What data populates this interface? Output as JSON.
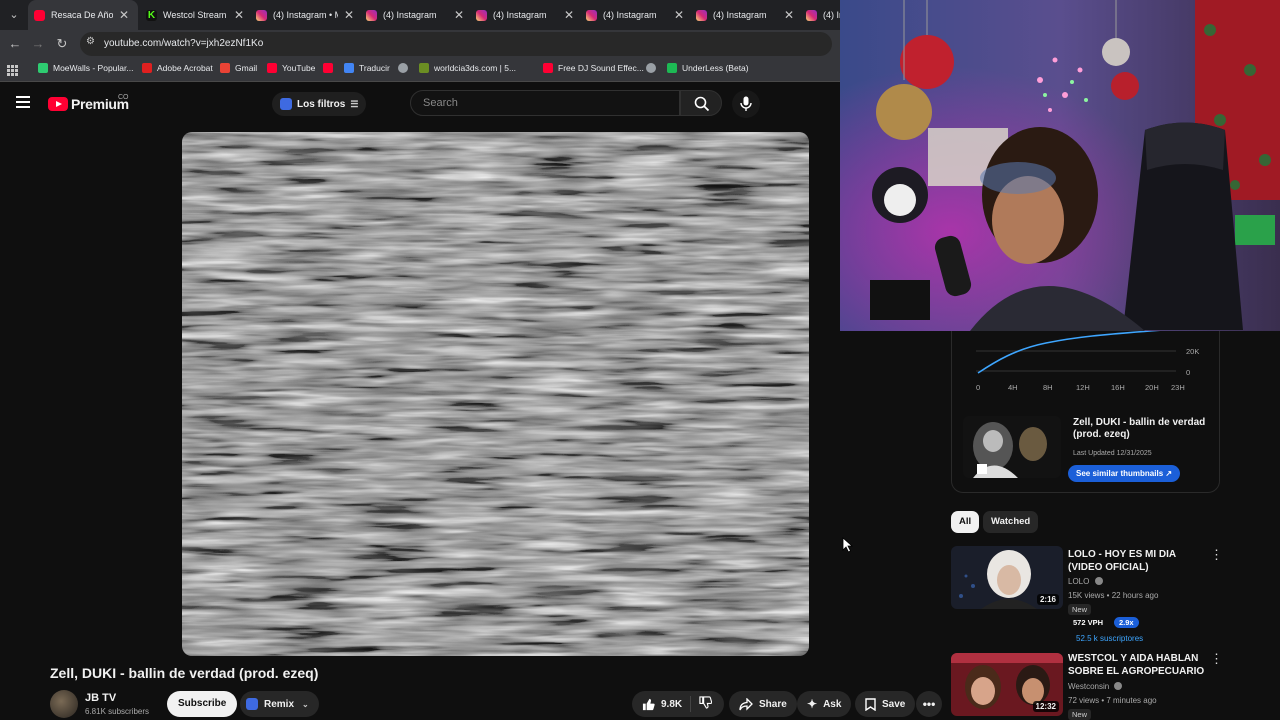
{
  "browser": {
    "tabs": [
      {
        "title": "Resaca De Año N",
        "icon": "youtube-icon"
      },
      {
        "title": "Westcol Stream -",
        "icon": "kick-icon"
      },
      {
        "title": "(4) Instagram • M",
        "icon": "instagram-icon"
      },
      {
        "title": "(4) Instagram",
        "icon": "instagram-icon"
      },
      {
        "title": "(4) Instagram",
        "icon": "instagram-icon"
      },
      {
        "title": "(4) Instagram",
        "icon": "instagram-icon"
      },
      {
        "title": "(4) Instagram",
        "icon": "instagram-icon"
      },
      {
        "title": "(4) In",
        "icon": "instagram-icon"
      }
    ],
    "url": "youtube.com/watch?v=jxh2ezNf1Ko",
    "bookmarks": [
      {
        "label": "MoeWalls - Popular...",
        "color": "#2ecc71"
      },
      {
        "label": "Adobe Acrobat",
        "color": "#e02020"
      },
      {
        "label": "Gmail",
        "color": "#ea4335"
      },
      {
        "label": "YouTube",
        "color": "#ff0033"
      },
      {
        "label": "",
        "color": "#ff0033"
      },
      {
        "label": "Traducir",
        "color": "#4285f4"
      },
      {
        "label": "",
        "color": "#9aa0a6"
      },
      {
        "label": "worldcia3ds.com | 5...",
        "color": "#6b8e23"
      },
      {
        "label": "Free DJ Sound Effec...",
        "color": "#ff0033"
      },
      {
        "label": "",
        "color": "#9aa0a6"
      },
      {
        "label": "UnderLess (Beta)",
        "color": "#1db954"
      }
    ]
  },
  "yt": {
    "logo_text": "Premium",
    "country": "CO",
    "filters_label": "Los filtros",
    "search_placeholder": "Search"
  },
  "video": {
    "title": "Zell, DUKI - ballin de verdad (prod. ezeq)",
    "channel": "JB TV",
    "subscribers": "6.81K subscribers",
    "subscribe_label": "Subscribe",
    "remix_label": "Remix",
    "likes": "9.8K",
    "share_label": "Share",
    "ask_label": "Ask",
    "save_label": "Save"
  },
  "stats": {
    "y_ticks": [
      "40K",
      "20K",
      "0"
    ],
    "x_ticks": [
      "0",
      "4H",
      "8H",
      "12H",
      "16H",
      "20H",
      "23H"
    ],
    "line_color": "#3ea6ff"
  },
  "thumb_card": {
    "title": "Zell, DUKI - ballin de verdad (prod. ezeq)",
    "updated": "Last Updated 12/31/2025",
    "button": "See similar thumbnails ↗"
  },
  "filter_chips": [
    "All",
    "Watched"
  ],
  "recommendations": [
    {
      "title": "LOLO - HOY ES MI DIA (VIDEO OFICIAL)",
      "channel": "LOLO",
      "meta": "15K views • 22 hours ago",
      "badge": "New",
      "vph": "572 VPH",
      "multiplier": "2.9x",
      "subs": "52.5 k suscriptores",
      "duration": "2:16"
    },
    {
      "title": "WESTCOL Y AIDA HABLAN SOBRE EL AGROPECUARIO",
      "channel": "Westconsin",
      "meta": "72 views • 7 minutes ago",
      "badge": "New",
      "duration": "12:32"
    }
  ]
}
